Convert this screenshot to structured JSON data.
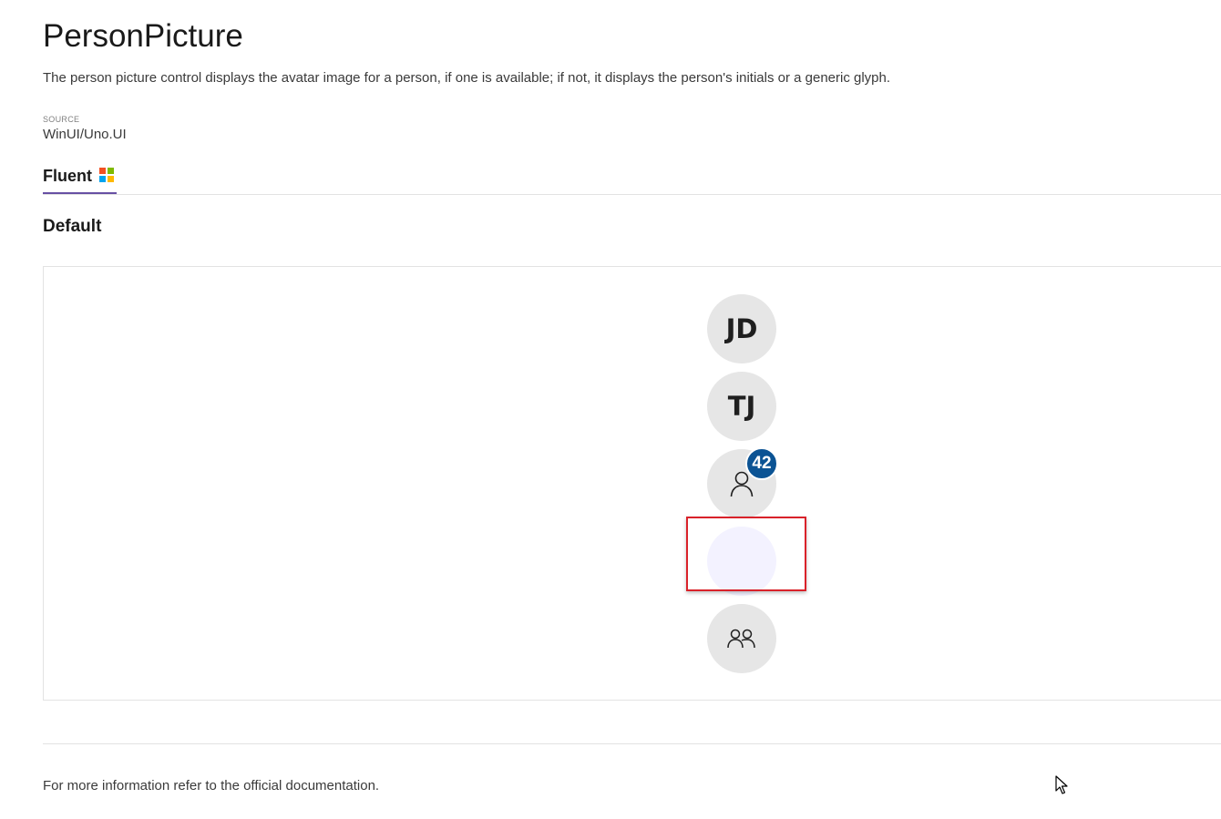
{
  "header": {
    "title": "PersonPicture",
    "description": "The person picture control displays the avatar image for a person, if one is available; if not, it displays the person's initials or a generic glyph.",
    "source_caption": "SOURCE",
    "source_value": "WinUI/Uno.UI"
  },
  "tabs": [
    {
      "label": "Fluent",
      "icon": "windows-logo-icon",
      "selected": true
    }
  ],
  "section": {
    "heading": "Default"
  },
  "samples": {
    "avatar_1": {
      "initials": "JD"
    },
    "avatar_2": {
      "initials": "TJ"
    },
    "avatar_3": {
      "icon": "person-icon",
      "badge": "42"
    },
    "avatar_4": {
      "icon": "blank-avatar"
    },
    "avatar_5": {
      "icon": "group-icon"
    }
  },
  "footer": {
    "prefix": "For more information refer to the ",
    "link": "official documentation."
  },
  "colors": {
    "tab_indicator": "#6750a4",
    "badge": "#0b5394",
    "highlight": "#d9222a",
    "avatar_bg": "#e6e6e6",
    "ms_red": "#f25022",
    "ms_green": "#7fba00",
    "ms_blue": "#00a4ef",
    "ms_yellow": "#ffb900"
  }
}
